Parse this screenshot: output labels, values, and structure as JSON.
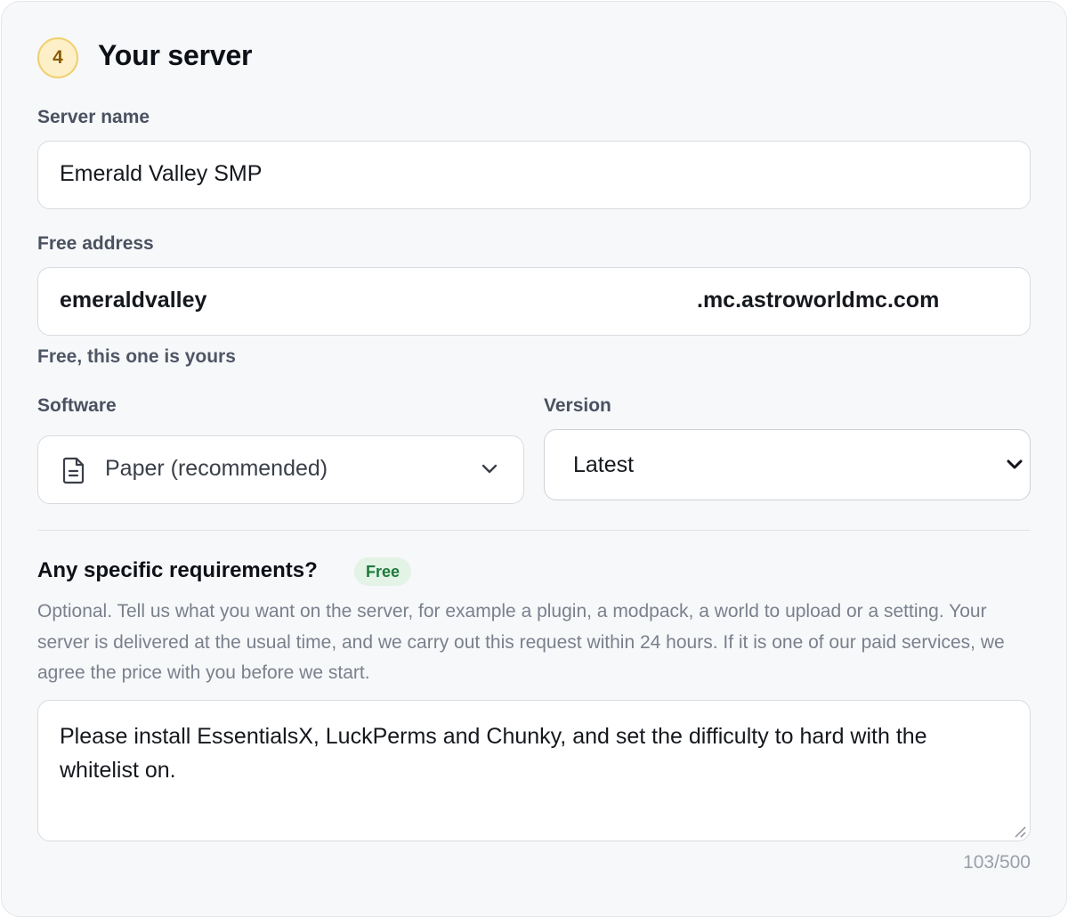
{
  "section": {
    "step_number": "4",
    "title": "Your server"
  },
  "server_name": {
    "label": "Server name",
    "value": "Emerald Valley SMP"
  },
  "address": {
    "label": "Free address",
    "subdomain": "emeraldvalley",
    "domain_suffix": ".mc.astroworldmc.com",
    "hint": "Free, this one is yours"
  },
  "software": {
    "label": "Software",
    "selected": "Paper (recommended)",
    "icon": "document-icon"
  },
  "version": {
    "label": "Version",
    "selected": "Latest"
  },
  "requirements": {
    "title": "Any specific requirements?",
    "badge": "Free",
    "description": "Optional. Tell us what you want on the server, for example a plugin, a modpack, a world to upload or a setting. Your server is delivered at the usual time, and we carry out this request within 24 hours. If it is one of our paid services, we agree the price with you before we start.",
    "value": "Please install EssentialsX, LuckPerms and Chunky, and set the difficulty to hard with the whitelist on.",
    "counter": "103/500"
  },
  "colors": {
    "badge_bg": "#fdf0c8",
    "badge_border": "#f1cf6e",
    "free_badge_bg": "#e3f3e6",
    "free_badge_text": "#1e7a3c"
  }
}
